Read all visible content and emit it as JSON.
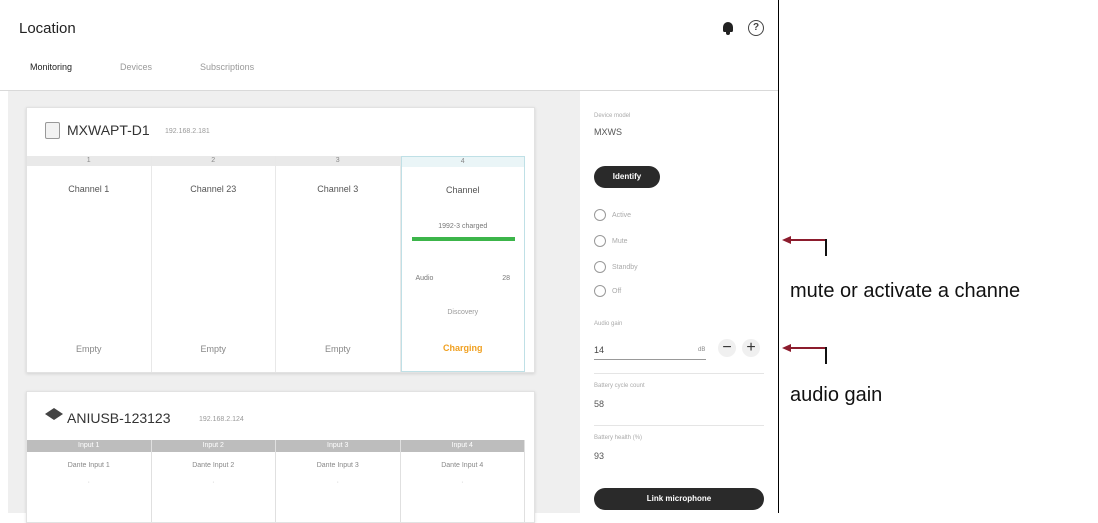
{
  "header": {
    "title": "Location"
  },
  "tabs": [
    {
      "label": "Monitoring",
      "active": true
    },
    {
      "label": "Devices",
      "active": false
    },
    {
      "label": "Subscriptions",
      "active": false
    }
  ],
  "device1": {
    "name": "MXWAPT-D1",
    "ip": "192.168.2.181",
    "columns": [
      {
        "num": "1",
        "name": "Channel 1",
        "status": "Empty"
      },
      {
        "num": "2",
        "name": "Channel 23",
        "status": "Empty"
      },
      {
        "num": "3",
        "name": "Channel 3",
        "status": "Empty"
      },
      {
        "num": "4",
        "name": "Channel",
        "firmware": "1992-3 charged",
        "audio_label": "Audio",
        "audio_value": "28",
        "discovery": "Discovery",
        "status": "Charging"
      }
    ]
  },
  "device2": {
    "name": "ANIUSB-123123",
    "ip": "192.168.2.124",
    "columns": [
      {
        "head": "Input 1",
        "name": "Dante Input 1"
      },
      {
        "head": "Input 2",
        "name": "Dante Input 2"
      },
      {
        "head": "Input 3",
        "name": "Dante Input 3"
      },
      {
        "head": "Input 4",
        "name": "Dante Input 4"
      }
    ]
  },
  "panel": {
    "model_label": "Device model",
    "model_value": "MXWS",
    "identify_label": "Identify",
    "radios": [
      "Active",
      "Mute",
      "Standby",
      "Off"
    ],
    "gain_label": "Audio gain",
    "gain_value": "14",
    "gain_unit": "dB",
    "minus": "−",
    "plus": "+",
    "battery_label": "Battery cycle count",
    "battery_value": "58",
    "health_label": "Battery health (%)",
    "health_value": "93",
    "link_label": "Link microphone"
  },
  "annotations": {
    "mute": "mute or activate a channe",
    "gain": "audio gain"
  },
  "colors": {
    "accent_green": "#3cb54a",
    "charging_orange": "#f0a020",
    "arrow_red": "#8c1c2d"
  }
}
